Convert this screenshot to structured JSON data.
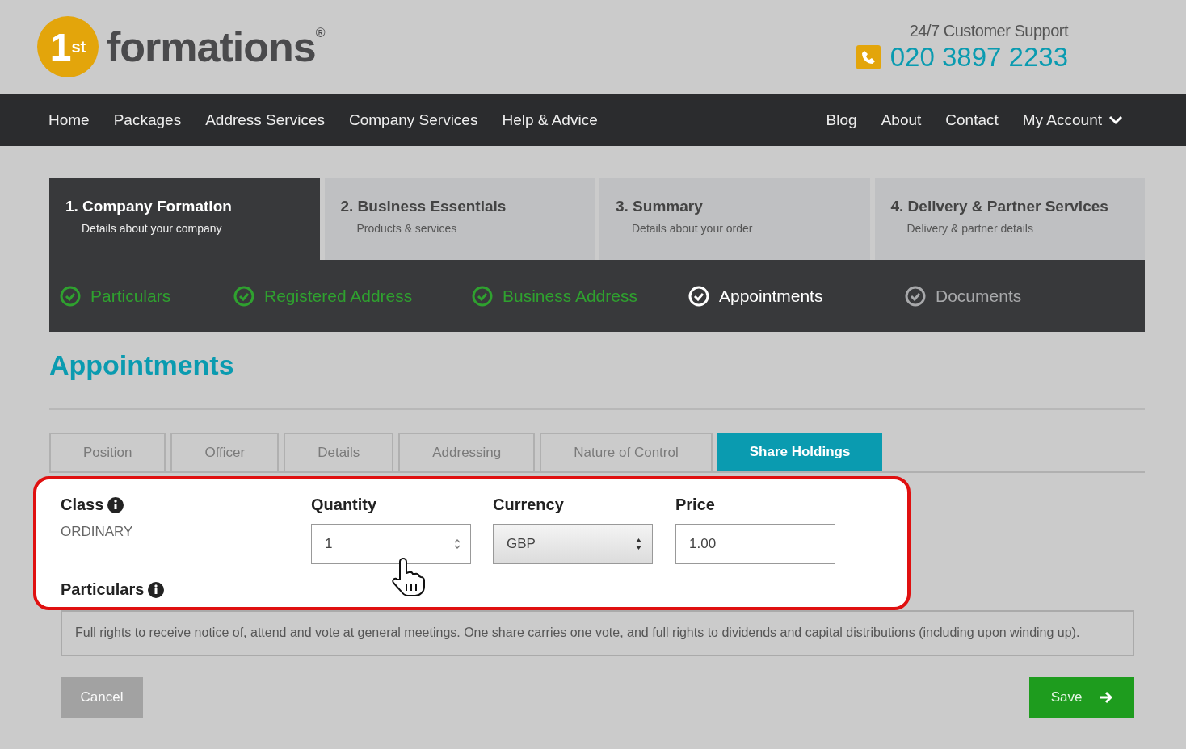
{
  "header": {
    "logo_badge": "1",
    "logo_badge_sup": "st",
    "logo_text": "formations",
    "logo_mark": "®",
    "support_label": "24/7 Customer Support",
    "phone": "020 3897 2233"
  },
  "nav": {
    "left": [
      "Home",
      "Packages",
      "Address Services",
      "Company Services",
      "Help & Advice"
    ],
    "right": [
      "Blog",
      "About",
      "Contact"
    ],
    "account": "My Account"
  },
  "steps": [
    {
      "title": "1. Company Formation",
      "subtitle": "Details about your company",
      "selected": true
    },
    {
      "title": "2. Business Essentials",
      "subtitle": "Products & services",
      "selected": false
    },
    {
      "title": "3. Summary",
      "subtitle": "Details about your order",
      "selected": false
    },
    {
      "title": "4. Delivery & Partner Services",
      "subtitle": "Delivery & partner details",
      "selected": false
    }
  ],
  "substeps": [
    {
      "label": "Particulars",
      "completed": true,
      "selected": false
    },
    {
      "label": "Registered Address",
      "completed": true,
      "selected": false
    },
    {
      "label": "Business Address",
      "completed": true,
      "selected": false
    },
    {
      "label": "Appointments",
      "completed": false,
      "selected": true
    },
    {
      "label": "Documents",
      "completed": false,
      "selected": false
    }
  ],
  "page_title": "Appointments",
  "tabs": [
    {
      "label": "Position",
      "selected": false
    },
    {
      "label": "Officer",
      "selected": false
    },
    {
      "label": "Details",
      "selected": false
    },
    {
      "label": "Addressing",
      "selected": false
    },
    {
      "label": "Nature of Control",
      "selected": false
    },
    {
      "label": "Share Holdings",
      "selected": true
    }
  ],
  "form": {
    "class_label": "Class",
    "class_value": "ORDINARY",
    "quantity_label": "Quantity",
    "quantity_value": "1",
    "currency_label": "Currency",
    "currency_value": "GBP",
    "price_label": "Price",
    "price_value": "1.00",
    "particulars_label": "Particulars",
    "particulars_value": "Full rights to receive notice of, attend and vote at general meetings. One share carries one vote, and full rights to dividends and capital distributions (including upon winding up)."
  },
  "buttons": {
    "cancel": "Cancel",
    "save": "Save"
  }
}
